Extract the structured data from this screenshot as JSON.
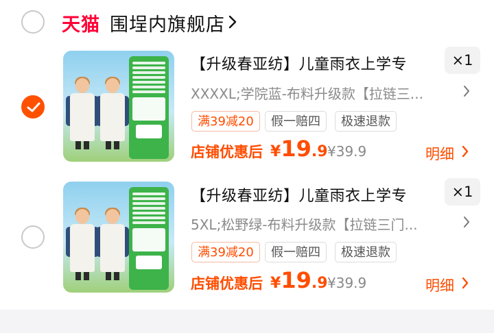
{
  "store": {
    "brand_logo": "天猫",
    "name": "围埕内旗舰店",
    "chevron_icon": "chevron-right-icon",
    "selected": false
  },
  "items": [
    {
      "selected": true,
      "title": "【升级春亚纺】儿童雨衣上学专",
      "quantity": "×1",
      "sku": "XXXXL;学院蓝-布料升级款【拉链三...",
      "tags": [
        "满39减20",
        "假一赔四",
        "极速退款"
      ],
      "price_label": "店铺优惠后",
      "currency": "¥",
      "price_int": "19",
      "price_dec": ".9",
      "original_price": "¥39.9",
      "detail_label": "明细",
      "panel_color": "#3db34a"
    },
    {
      "selected": false,
      "title": "【升级春亚纺】儿童雨衣上学专",
      "quantity": "×1",
      "sku": "5XL;松野绿-布料升级款【拉链三门...",
      "tags": [
        "满39减20",
        "假一赔四",
        "极速退款"
      ],
      "price_label": "店铺优惠后",
      "currency": "¥",
      "price_int": "19",
      "price_dec": ".9",
      "original_price": "¥39.9",
      "detail_label": "明细",
      "panel_color": "#3db34a"
    }
  ],
  "colors": {
    "accent": "#ff5000",
    "price": "#ff4d00",
    "tmall_red": "#ff0036"
  }
}
